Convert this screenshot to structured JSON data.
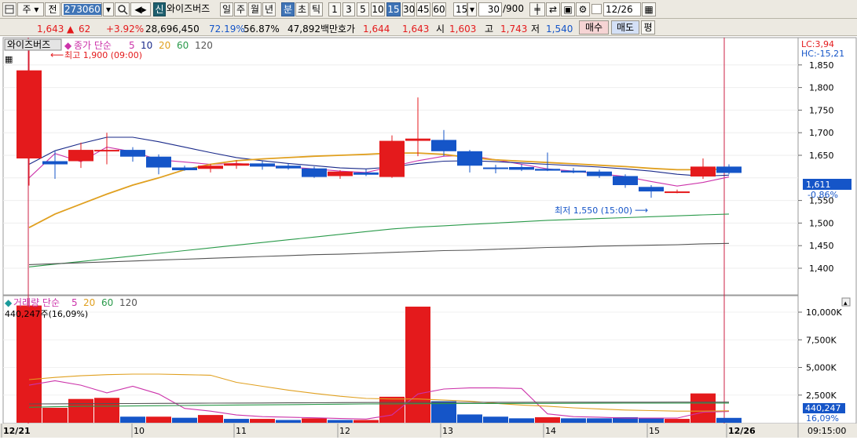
{
  "toolbar": {
    "market_label": "주",
    "jeon_label": "전",
    "code_value": "273060",
    "name_badge": "신",
    "stock_name": "와이즈버즈",
    "periods": [
      "일",
      "주",
      "월",
      "년",
      "분",
      "초",
      "틱"
    ],
    "selected_period": "분",
    "intervals": [
      "1",
      "3",
      "5",
      "10",
      "15",
      "30",
      "45",
      "60"
    ],
    "selected_interval": "15",
    "interval_select": "15",
    "count_value": "30",
    "count_total": "/900",
    "date_value": "12/26"
  },
  "quote": {
    "price": "1,643",
    "change": "62",
    "change_pct": "+3.92%",
    "volume": "28,696,450",
    "ratio1": "72.19%",
    "ratio2": "56.87%",
    "amount": "47,892백만",
    "bid_label": "호가",
    "bid1": "1,644",
    "bid2": "1,643",
    "open_label": "시",
    "open": "1,603",
    "high_label": "고",
    "high": "1,743",
    "low_label": "저",
    "low": "1,540",
    "buy_button": "매수",
    "sell_button": "매도",
    "eval_button": "평"
  },
  "price_panel": {
    "name_tag": "와이즈버즈",
    "legend_title": "종가 단순",
    "ma_labels": [
      "5",
      "10",
      "20",
      "60",
      "120"
    ],
    "high_annotation": "최고 1,900 (09:00)",
    "low_annotation": "최저 1,550 (15:00)",
    "lc_label": "LC:3,94",
    "hc_label": "HC:-15,21",
    "y_ticks": [
      "1,850",
      "1,800",
      "1,750",
      "1,700",
      "1,650",
      "1,550",
      "1,500",
      "1,450",
      "1,400"
    ],
    "current_price_tag": "1,611",
    "current_change_tag": "-0.86%"
  },
  "volume_panel": {
    "legend_title": "거래량 단순",
    "ma_labels": [
      "5",
      "20",
      "60",
      "120"
    ],
    "info": "440,247주(16,09%)",
    "y_ticks": [
      "10,000K",
      "7,500K",
      "5,000K",
      "2,500K"
    ],
    "current_volume_tag": "440,247",
    "current_volume_pct": "16,09%"
  },
  "x_axis": {
    "labels": [
      "12/21",
      "10",
      "11",
      "12",
      "13",
      "14",
      "15",
      "12/26"
    ],
    "time": "09:15:00"
  },
  "colors": {
    "up": "#e41a1c",
    "down": "#1555c8",
    "ma5": "#cc33aa",
    "ma10": "#1a2a8a",
    "ma20": "#e0a020",
    "ma60": "#2a9a4a",
    "ma120": "#555555",
    "toolbar_bg": "#ece9e1",
    "selected": "#3f74b6"
  },
  "chart_data": [
    {
      "type": "candlestick",
      "title": "와이즈버즈",
      "candles": [
        {
          "o": 1643,
          "h": 1900,
          "l": 1583,
          "c": 1838
        },
        {
          "o": 1637,
          "h": 1660,
          "l": 1598,
          "c": 1630
        },
        {
          "o": 1637,
          "h": 1678,
          "l": 1622,
          "c": 1662
        },
        {
          "o": 1662,
          "h": 1700,
          "l": 1630,
          "c": 1662
        },
        {
          "o": 1662,
          "h": 1668,
          "l": 1636,
          "c": 1647
        },
        {
          "o": 1647,
          "h": 1652,
          "l": 1608,
          "c": 1623
        },
        {
          "o": 1623,
          "h": 1627,
          "l": 1616,
          "c": 1617
        },
        {
          "o": 1620,
          "h": 1631,
          "l": 1612,
          "c": 1627
        },
        {
          "o": 1627,
          "h": 1639,
          "l": 1620,
          "c": 1632
        },
        {
          "o": 1632,
          "h": 1637,
          "l": 1618,
          "c": 1625
        },
        {
          "o": 1627,
          "h": 1632,
          "l": 1618,
          "c": 1621
        },
        {
          "o": 1621,
          "h": 1625,
          "l": 1600,
          "c": 1602
        },
        {
          "o": 1604,
          "h": 1617,
          "l": 1598,
          "c": 1614
        },
        {
          "o": 1612,
          "h": 1619,
          "l": 1604,
          "c": 1607
        },
        {
          "o": 1602,
          "h": 1694,
          "l": 1600,
          "c": 1682
        },
        {
          "o": 1682,
          "h": 1778,
          "l": 1648,
          "c": 1687
        },
        {
          "o": 1684,
          "h": 1706,
          "l": 1648,
          "c": 1659
        },
        {
          "o": 1659,
          "h": 1662,
          "l": 1612,
          "c": 1627
        },
        {
          "o": 1623,
          "h": 1629,
          "l": 1610,
          "c": 1620
        },
        {
          "o": 1624,
          "h": 1630,
          "l": 1615,
          "c": 1618
        },
        {
          "o": 1620,
          "h": 1656,
          "l": 1615,
          "c": 1616
        },
        {
          "o": 1616,
          "h": 1622,
          "l": 1610,
          "c": 1612
        },
        {
          "o": 1614,
          "h": 1618,
          "l": 1600,
          "c": 1604
        },
        {
          "o": 1604,
          "h": 1608,
          "l": 1578,
          "c": 1584
        },
        {
          "o": 1580,
          "h": 1584,
          "l": 1556,
          "c": 1570
        },
        {
          "o": 1568,
          "h": 1574,
          "l": 1566,
          "c": 1570
        },
        {
          "o": 1603,
          "h": 1643,
          "l": 1598,
          "c": 1625
        },
        {
          "o": 1625,
          "h": 1630,
          "l": 1608,
          "c": 1611
        }
      ],
      "ma": {
        "5": [
          1600,
          1654,
          1636,
          1668,
          1658,
          1640,
          1635,
          1630,
          1632,
          1628,
          1624,
          1620,
          1615,
          1612,
          1625,
          1638,
          1648,
          1650,
          1640,
          1630,
          1620,
          1615,
          1609,
          1603,
          1592,
          1582,
          1590,
          1602
        ],
        "10": [
          1630,
          1660,
          1676,
          1690,
          1690,
          1680,
          1668,
          1656,
          1645,
          1638,
          1632,
          1627,
          1622,
          1620,
          1624,
          1632,
          1637,
          1638,
          1636,
          1633,
          1630,
          1627,
          1624,
          1620,
          1615,
          1608,
          1604,
          1606
        ],
        "20": [
          1490,
          1520,
          1542,
          1564,
          1584,
          1600,
          1618,
          1630,
          1638,
          1642,
          1645,
          1648,
          1650,
          1652,
          1655,
          1655,
          1652,
          1645,
          1640,
          1637,
          1634,
          1631,
          1628,
          1625,
          1621,
          1618,
          1618,
          1620
        ],
        "60": [
          1403,
          1409,
          1415,
          1421,
          1427,
          1433,
          1439,
          1445,
          1451,
          1457,
          1463,
          1469,
          1475,
          1481,
          1487,
          1491,
          1494,
          1497,
          1500,
          1503,
          1506,
          1508,
          1510,
          1512,
          1514,
          1516,
          1518,
          1520
        ],
        "120": [
          1408,
          1410,
          1412,
          1414,
          1416,
          1418,
          1420,
          1422,
          1424,
          1426,
          1428,
          1430,
          1431,
          1433,
          1435,
          1437,
          1439,
          1440,
          1442,
          1444,
          1446,
          1447,
          1449,
          1450,
          1451,
          1452,
          1454,
          1455
        ]
      },
      "ylim": [
        1370,
        1930
      ]
    },
    {
      "type": "bar",
      "title": "거래량",
      "values": [
        10600,
        1350,
        2150,
        2250,
        550,
        550,
        450,
        700,
        350,
        350,
        250,
        400,
        250,
        250,
        2350,
        10500,
        1950,
        750,
        550,
        400,
        500,
        400,
        400,
        500,
        450,
        350,
        2650,
        440
      ],
      "up": [
        true,
        true,
        true,
        true,
        false,
        true,
        false,
        true,
        false,
        true,
        false,
        true,
        false,
        true,
        true,
        true,
        false,
        false,
        false,
        false,
        true,
        false,
        false,
        false,
        false,
        true,
        true,
        false
      ],
      "ma": {
        "5": [
          3400,
          3800,
          3400,
          2700,
          3300,
          2600,
          1300,
          1050,
          700,
          550,
          500,
          450,
          380,
          330,
          700,
          2600,
          3050,
          3150,
          3150,
          3100,
          800,
          550,
          500,
          420,
          420,
          420,
          950,
          1020
        ],
        "20": [
          3900,
          4100,
          4250,
          4350,
          4400,
          4400,
          4350,
          4300,
          3650,
          3300,
          2950,
          2650,
          2400,
          2200,
          2150,
          2150,
          2050,
          1950,
          1750,
          1600,
          1500,
          1350,
          1250,
          1150,
          1100,
          1050,
          1050,
          1080
        ],
        "60": [
          1400,
          1450,
          1480,
          1500,
          1520,
          1540,
          1560,
          1580,
          1600,
          1620,
          1640,
          1660,
          1680,
          1700,
          1710,
          1720,
          1730,
          1740,
          1745,
          1750,
          1755,
          1760,
          1765,
          1770,
          1770,
          1775,
          1780,
          1780
        ],
        "120": [
          1700,
          1710,
          1720,
          1730,
          1740,
          1750,
          1760,
          1770,
          1780,
          1790,
          1800,
          1810,
          1820,
          1830,
          1840,
          1840,
          1845,
          1845,
          1850,
          1850,
          1855,
          1855,
          1858,
          1860,
          1860,
          1862,
          1864,
          1865
        ]
      },
      "ylim": [
        0,
        11400
      ],
      "unit": "K"
    }
  ]
}
